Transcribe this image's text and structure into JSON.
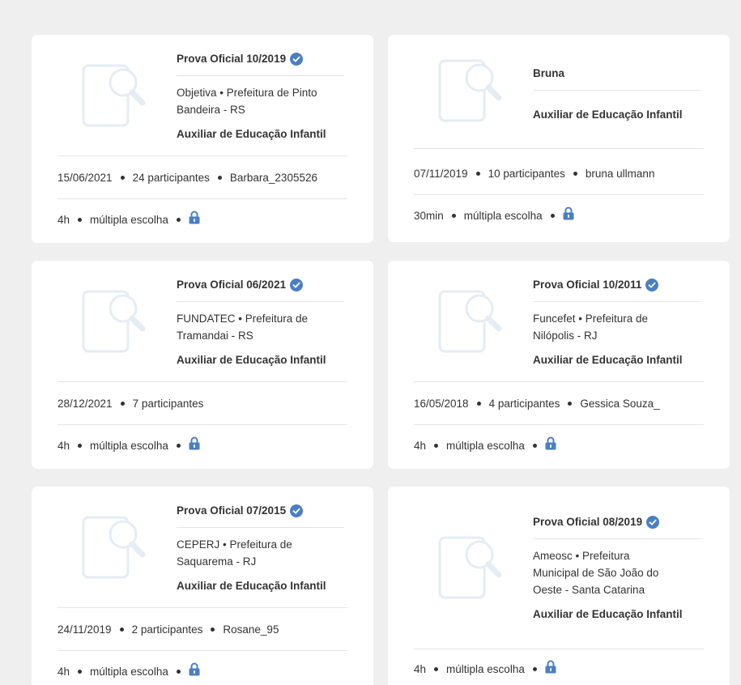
{
  "colors": {
    "accent": "#4a7fc1",
    "background": "#efefef",
    "card": "#ffffff",
    "placeholder_icon": "#e6ecf4"
  },
  "icons": {
    "thumbnail": "document-search-icon",
    "verified": "verified-check-icon",
    "locked": "lock-icon"
  },
  "cards": [
    {
      "title": "Prova Oficial 10/2019",
      "verified": true,
      "board_line1": "Objetiva  •  Prefeitura de Pinto",
      "board_line2": "Bandeira - RS",
      "board_line3": "",
      "role": "Auxiliar de Educação Infantil",
      "date": "15/06/2021",
      "participants": "24 participantes",
      "author": "Barbara_2305526",
      "duration": "4h",
      "type": "múltipla escolha"
    },
    {
      "title": "Bruna",
      "verified": false,
      "board_line1": "",
      "board_line2": "",
      "board_line3": "",
      "role": "Auxiliar de Educação Infantil",
      "date": "07/11/2019",
      "participants": "10 participantes",
      "author": "bruna ullmann",
      "duration": "30min",
      "type": "múltipla escolha"
    },
    {
      "title": "Prova Oficial 06/2021",
      "verified": true,
      "board_line1": "FUNDATEC  •  Prefeitura de",
      "board_line2": "Tramandai - RS",
      "board_line3": "",
      "role": "Auxiliar de Educação Infantil",
      "date": "28/12/2021",
      "participants": "7 participantes",
      "author": "",
      "duration": "4h",
      "type": "múltipla escolha"
    },
    {
      "title": "Prova Oficial 10/2011",
      "verified": true,
      "board_line1": "Funcefet  •  Prefeitura de",
      "board_line2": "Nilópolis - RJ",
      "board_line3": "",
      "role": "Auxiliar de Educação Infantil",
      "date": "16/05/2018",
      "participants": "4 participantes",
      "author": "Gessica Souza_",
      "duration": "4h",
      "type": "múltipla escolha"
    },
    {
      "title": "Prova Oficial 07/2015",
      "verified": true,
      "board_line1": "CEPERJ  •  Prefeitura de",
      "board_line2": "Saquarema - RJ",
      "board_line3": "",
      "role": "Auxiliar de Educação Infantil",
      "date": "24/11/2019",
      "participants": "2 participantes",
      "author": "Rosane_95",
      "duration": "4h",
      "type": "múltipla escolha"
    },
    {
      "title": "Prova Oficial 08/2019",
      "verified": true,
      "board_line1": "Ameosc  •  Prefeitura",
      "board_line2": "Municipal de São João do",
      "board_line3": "Oeste - Santa Catarina",
      "role": "Auxiliar de Educação Infantil",
      "date": "",
      "participants": "",
      "author": "",
      "duration": "4h",
      "type": "múltipla escolha"
    }
  ]
}
